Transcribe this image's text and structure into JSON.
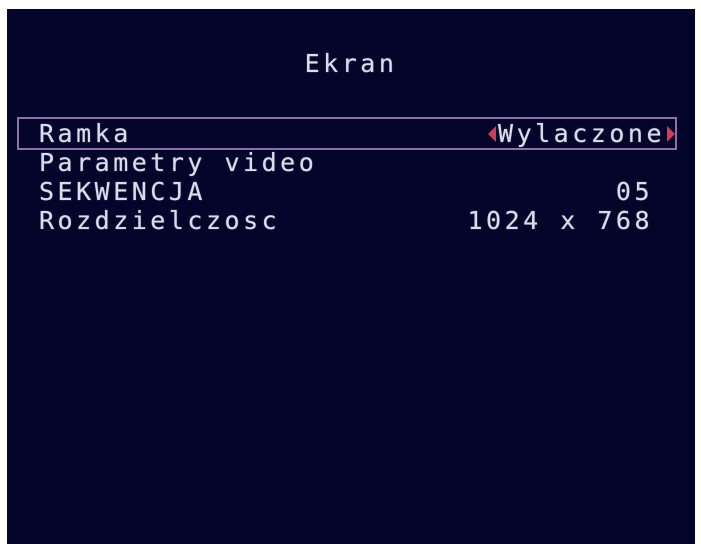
{
  "screen": {
    "title": "Ekran",
    "menu": [
      {
        "label": "Ramka",
        "value": "Wylaczone",
        "selected": true
      },
      {
        "label": "Parametry video",
        "value": ""
      },
      {
        "label": "SEKWENCJA",
        "value": "05"
      },
      {
        "label": "Rozdzielczosc",
        "value": "1024 x 768"
      }
    ]
  },
  "colors": {
    "background": "#04052a",
    "text": "#dcdce8",
    "selection_border": "#8f6fa8",
    "arrow": "#d23a58"
  }
}
